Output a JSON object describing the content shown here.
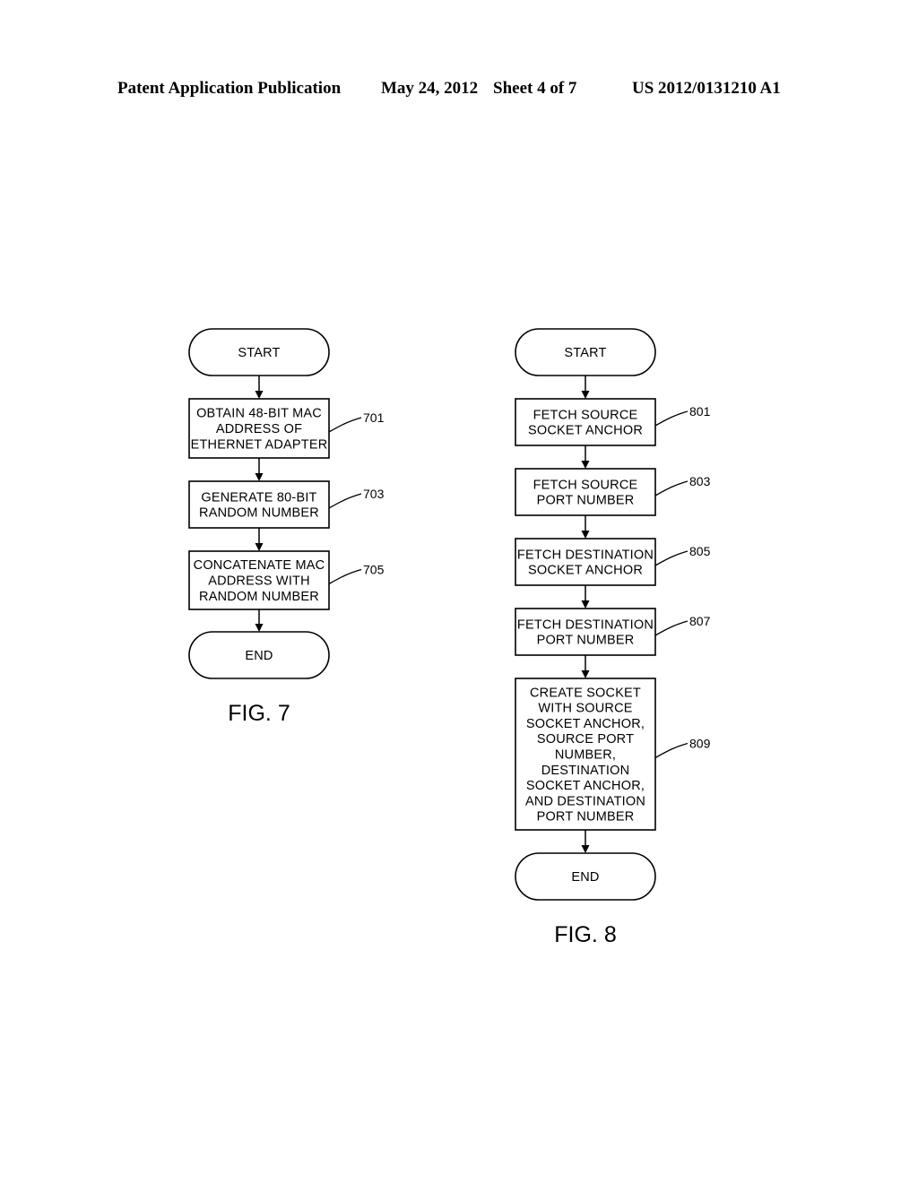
{
  "header": {
    "publication": "Patent Application Publication",
    "date": "May 24, 2012",
    "sheet": "Sheet 4 of 7",
    "number": "US 2012/0131210 A1"
  },
  "figures": [
    {
      "id": "fig7",
      "caption": "FIG. 7",
      "nodes": [
        {
          "id": "start",
          "type": "terminator",
          "lines": [
            "START"
          ],
          "ref": ""
        },
        {
          "id": "701",
          "type": "process",
          "lines": [
            "OBTAIN 48-BIT MAC",
            "ADDRESS OF",
            "ETHERNET ADAPTER"
          ],
          "ref": "701"
        },
        {
          "id": "703",
          "type": "process",
          "lines": [
            "GENERATE 80-BIT",
            "RANDOM NUMBER"
          ],
          "ref": "703"
        },
        {
          "id": "705",
          "type": "process",
          "lines": [
            "CONCATENATE MAC",
            "ADDRESS WITH",
            "RANDOM NUMBER"
          ],
          "ref": "705"
        },
        {
          "id": "end",
          "type": "terminator",
          "lines": [
            "END"
          ],
          "ref": ""
        }
      ]
    },
    {
      "id": "fig8",
      "caption": "FIG. 8",
      "nodes": [
        {
          "id": "start",
          "type": "terminator",
          "lines": [
            "START"
          ],
          "ref": ""
        },
        {
          "id": "801",
          "type": "process",
          "lines": [
            "FETCH SOURCE",
            "SOCKET ANCHOR"
          ],
          "ref": "801"
        },
        {
          "id": "803",
          "type": "process",
          "lines": [
            "FETCH SOURCE",
            "PORT NUMBER"
          ],
          "ref": "803"
        },
        {
          "id": "805",
          "type": "process",
          "lines": [
            "FETCH DESTINATION",
            "SOCKET ANCHOR"
          ],
          "ref": "805"
        },
        {
          "id": "807",
          "type": "process",
          "lines": [
            "FETCH DESTINATION",
            "PORT NUMBER"
          ],
          "ref": "807"
        },
        {
          "id": "809",
          "type": "process",
          "lines": [
            "CREATE SOCKET",
            "WITH SOURCE",
            "SOCKET ANCHOR,",
            "SOURCE PORT",
            "NUMBER,",
            "DESTINATION",
            "SOCKET ANCHOR,",
            "AND DESTINATION",
            "PORT NUMBER"
          ],
          "ref": "809"
        },
        {
          "id": "end",
          "type": "terminator",
          "lines": [
            "END"
          ],
          "ref": ""
        }
      ]
    }
  ]
}
